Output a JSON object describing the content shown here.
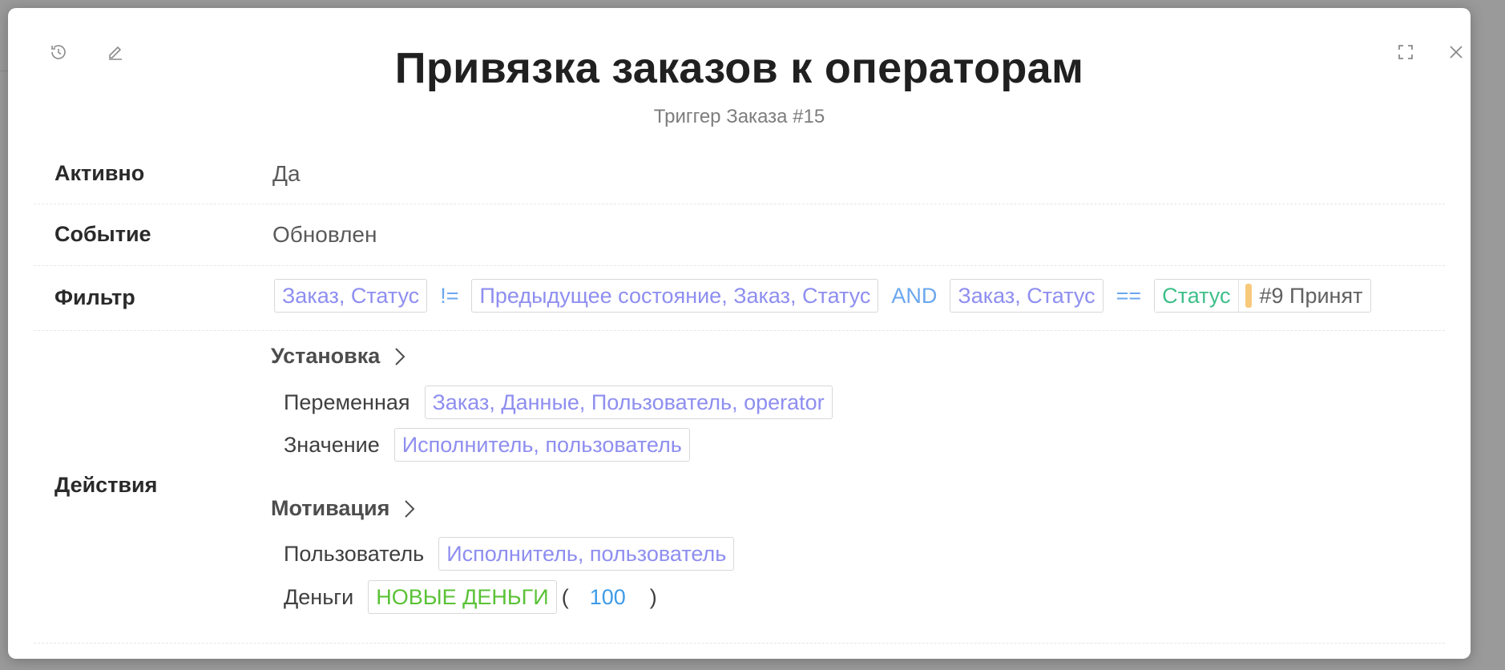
{
  "header": {
    "title": "Привязка заказов к операторам",
    "subtitle": "Триггер Заказа #15",
    "icons": [
      "history-icon",
      "edit-icon",
      "fullscreen-icon",
      "close-icon"
    ]
  },
  "fields": {
    "active": {
      "label": "Активно",
      "value": "Да"
    },
    "event": {
      "label": "Событие",
      "value": "Обновлен"
    },
    "filter": {
      "label": "Фильтр",
      "left1": "Заказ, Статус",
      "op1": "!=",
      "right1": "Предыдущее состояние, Заказ, Статус",
      "logic": "AND",
      "left2": "Заказ, Статус",
      "op2": "==",
      "status_label": "Статус",
      "status_value": "#9 Принят",
      "status_color": "#f7c97a"
    },
    "actions": {
      "label": "Действия",
      "set": {
        "title": "Установка",
        "var_label": "Переменная",
        "var_value": "Заказ, Данные, Пользователь, operator",
        "val_label": "Значение",
        "val_value": "Исполнитель, пользователь"
      },
      "motivation": {
        "title": "Мотивация",
        "user_label": "Пользователь",
        "user_value": "Исполнитель, пользователь",
        "money_label": "Деньги",
        "money_func": "НОВЫЕ ДЕНЬГИ",
        "paren_open": "(",
        "money_amount": "100",
        "paren_close": ")"
      }
    }
  },
  "colors": {
    "chip_text": "#8e8ef0",
    "operator": "#6aa7ee",
    "status_chip": "#3fbf8a",
    "func_chip": "#5ac236",
    "number": "#3e9be8"
  }
}
